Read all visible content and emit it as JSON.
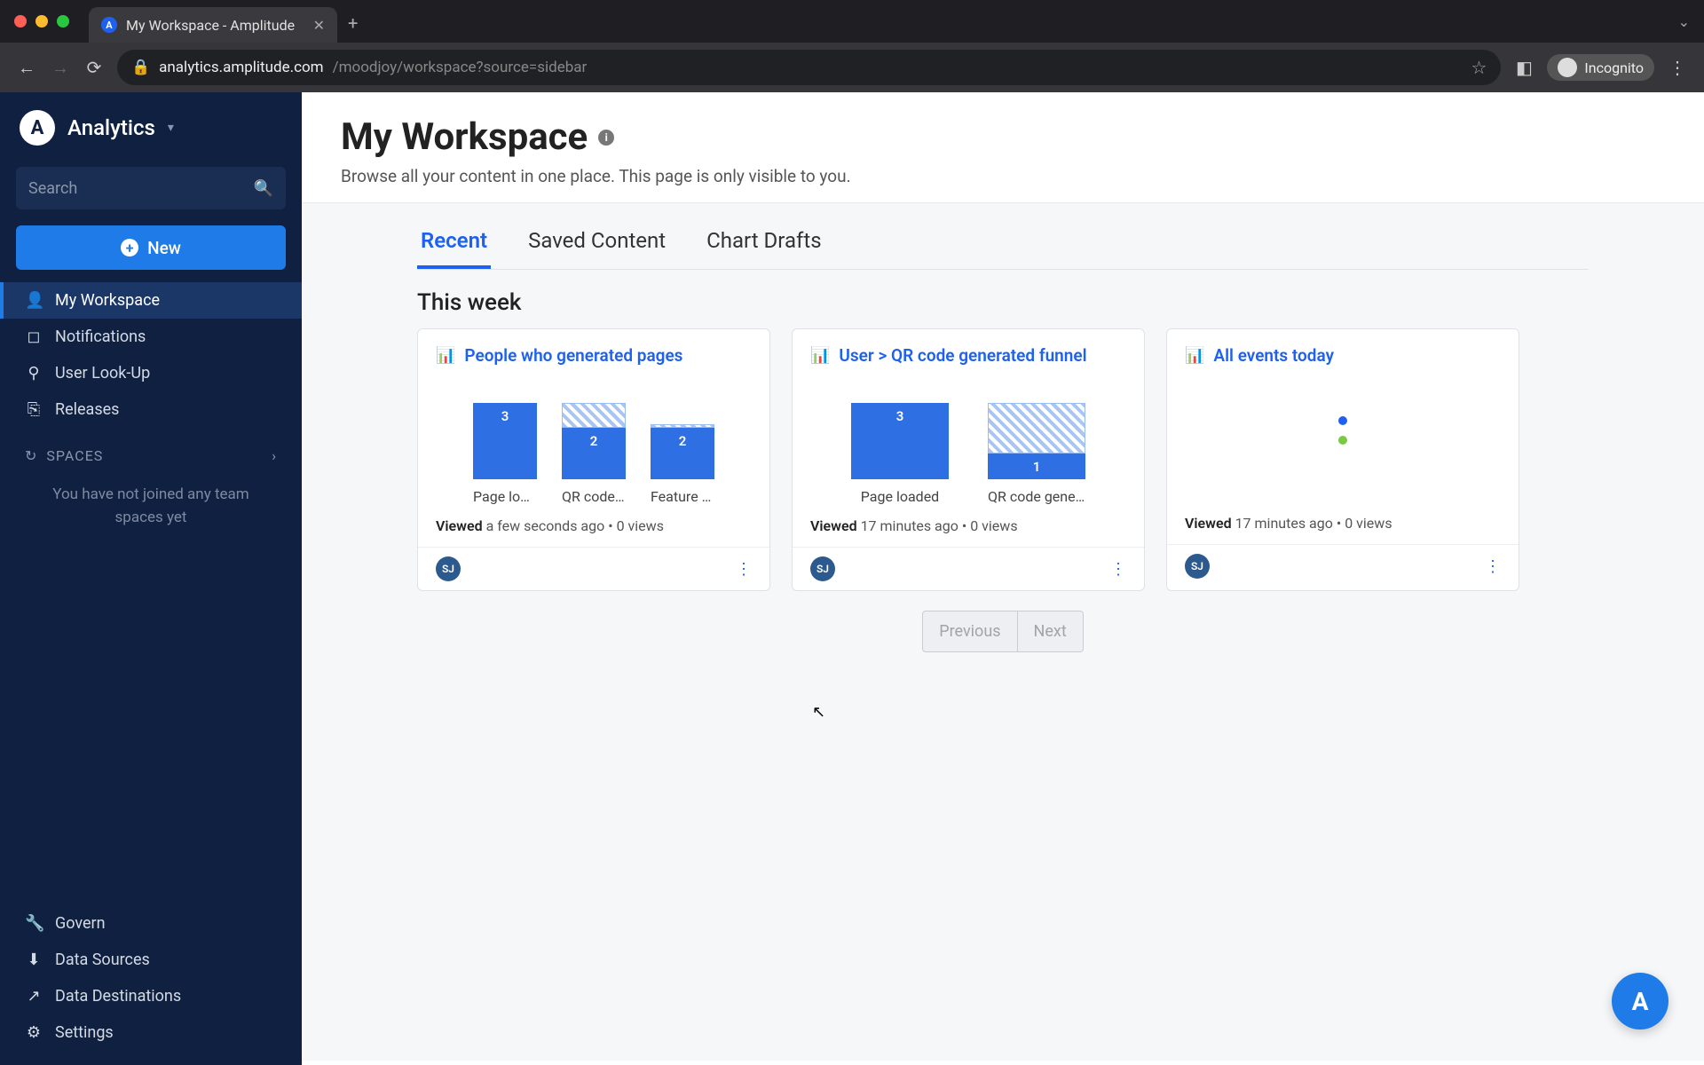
{
  "browser": {
    "tab_title": "My Workspace - Amplitude",
    "url_host": "analytics.amplitude.com",
    "url_path": "/moodjoy/workspace?source=sidebar",
    "incognito_label": "Incognito"
  },
  "sidebar": {
    "brand": "Analytics",
    "search_placeholder": "Search",
    "new_button": "New",
    "nav": [
      {
        "label": "My Workspace",
        "icon": "person-icon",
        "active": true
      },
      {
        "label": "Notifications",
        "icon": "bell-icon",
        "active": false
      },
      {
        "label": "User Look-Up",
        "icon": "user-lookup-icon",
        "active": false
      },
      {
        "label": "Releases",
        "icon": "releases-icon",
        "active": false
      }
    ],
    "spaces_header": "SPACES",
    "spaces_empty": "You have not joined any team spaces yet",
    "bottom": [
      {
        "label": "Govern",
        "icon": "wrench-icon"
      },
      {
        "label": "Data Sources",
        "icon": "download-icon"
      },
      {
        "label": "Data Destinations",
        "icon": "share-icon"
      },
      {
        "label": "Settings",
        "icon": "gear-icon"
      }
    ]
  },
  "page": {
    "title": "My Workspace",
    "subtitle": "Browse all your content in one place. This page is only visible to you.",
    "tabs": [
      "Recent",
      "Saved Content",
      "Chart Drafts"
    ],
    "active_tab": "Recent",
    "section_title": "This week",
    "pagination": {
      "prev": "Previous",
      "next": "Next"
    }
  },
  "cards": [
    {
      "title": "People who generated pages",
      "viewed_label": "Viewed",
      "viewed_time": "a few seconds ago",
      "views": "0 views",
      "avatar": "SJ"
    },
    {
      "title": "User > QR code generated funnel",
      "viewed_label": "Viewed",
      "viewed_time": "17 minutes ago",
      "views": "0 views",
      "avatar": "SJ"
    },
    {
      "title": "All events today",
      "viewed_label": "Viewed",
      "viewed_time": "17 minutes ago",
      "views": "0 views",
      "avatar": "SJ"
    }
  ],
  "chart_data": [
    {
      "type": "bar",
      "title": "People who generated pages",
      "categories": [
        "Page load…",
        "QR code g…",
        "Feature p…"
      ],
      "series": [
        {
          "name": "solid",
          "values": [
            3,
            2,
            2
          ]
        },
        {
          "name": "hatched",
          "values": [
            0,
            1,
            0.15
          ]
        }
      ],
      "ylim": [
        0,
        3
      ]
    },
    {
      "type": "bar",
      "title": "User > QR code generated funnel",
      "categories": [
        "Page loaded",
        "QR code generat…"
      ],
      "series": [
        {
          "name": "solid",
          "values": [
            3,
            1
          ]
        },
        {
          "name": "hatched",
          "values": [
            0,
            2
          ]
        }
      ],
      "ylim": [
        0,
        3
      ]
    },
    {
      "type": "scatter",
      "title": "All events today",
      "legend": [
        "blue",
        "green"
      ]
    }
  ]
}
